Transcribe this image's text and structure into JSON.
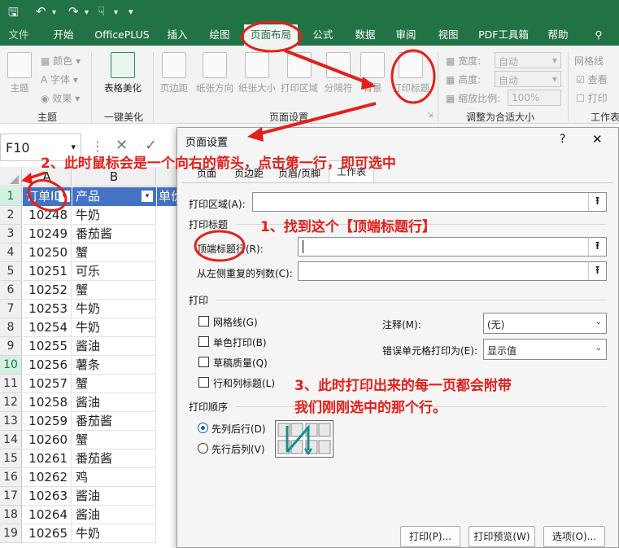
{
  "tabs": [
    "文件",
    "开始",
    "OfficePLUS",
    "插入",
    "绘图",
    "页面布局",
    "公式",
    "数据",
    "审阅",
    "视图",
    "PDF工具箱",
    "帮助"
  ],
  "ribbon": {
    "theme": {
      "btn": "主题",
      "colors": "颜色",
      "fonts": "字体",
      "effects": "效果",
      "group": "主题"
    },
    "beautify": {
      "btn": "表格美化",
      "group": "一键美化"
    },
    "page_setup": {
      "margins": "页边距",
      "orientation": "纸张方向",
      "size": "纸张大小",
      "print_area": "打印区域",
      "breaks": "分隔符",
      "background": "背景",
      "print_titles": "打印标题",
      "group": "页面设置"
    },
    "scale": {
      "width_label": "宽度:",
      "width_val": "自动",
      "height_label": "高度:",
      "height_val": "自动",
      "scale_label": "缩放比例:",
      "scale_val": "100%",
      "group": "调整为合适大小"
    },
    "sheet_opts": {
      "gridlines": "网格线",
      "view": "查看",
      "print": "打印",
      "group": "工作表"
    }
  },
  "namebox": "F10",
  "sheet": {
    "col_a": "A",
    "col_b": "B",
    "header": {
      "a": "订单ID",
      "b": "产品",
      "c": "单价"
    },
    "rows": [
      {
        "n": "2",
        "id": "10248",
        "p": "牛奶"
      },
      {
        "n": "3",
        "id": "10249",
        "p": "番茄酱"
      },
      {
        "n": "4",
        "id": "10250",
        "p": "蟹"
      },
      {
        "n": "5",
        "id": "10251",
        "p": "可乐"
      },
      {
        "n": "6",
        "id": "10252",
        "p": "蟹"
      },
      {
        "n": "7",
        "id": "10253",
        "p": "牛奶"
      },
      {
        "n": "8",
        "id": "10254",
        "p": "牛奶"
      },
      {
        "n": "9",
        "id": "10255",
        "p": "酱油"
      },
      {
        "n": "10",
        "id": "10256",
        "p": "薯条"
      },
      {
        "n": "11",
        "id": "10257",
        "p": "蟹"
      },
      {
        "n": "12",
        "id": "10258",
        "p": "酱油"
      },
      {
        "n": "13",
        "id": "10259",
        "p": "番茄酱"
      },
      {
        "n": "14",
        "id": "10260",
        "p": "蟹"
      },
      {
        "n": "15",
        "id": "10261",
        "p": "番茄酱"
      },
      {
        "n": "16",
        "id": "10262",
        "p": "鸡"
      },
      {
        "n": "17",
        "id": "10263",
        "p": "酱油"
      },
      {
        "n": "18",
        "id": "10264",
        "p": "酱油"
      },
      {
        "n": "19",
        "id": "10265",
        "p": "牛奶"
      }
    ]
  },
  "dialog": {
    "title": "页面设置",
    "help": "?",
    "close": "✕",
    "tabs": [
      "页面",
      "页边距",
      "页眉/页脚",
      "工作表"
    ],
    "print_area": "打印区域(A):",
    "print_titles": "打印标题",
    "rows_to_repeat": "顶端标题行(R):",
    "cols_to_repeat": "从左侧重复的列数(C):",
    "print": "打印",
    "gridlines": "网格线(G)",
    "bw": "单色打印(B)",
    "draft": "草稿质量(Q)",
    "headings": "行和列标题(L)",
    "comments_label": "注释(M):",
    "comments_val": "(无)",
    "errors_label": "错误单元格打印为(E):",
    "errors_val": "显示值",
    "page_order": "打印顺序",
    "down_over": "先列后行(D)",
    "over_down": "先行后列(V)",
    "btn_print": "打印(P)...",
    "btn_preview": "打印预览(W)",
    "btn_options": "选项(O)..."
  },
  "annotations": {
    "step1": "1、找到这个【顶端标题行】",
    "step2": "2、此时鼠标会是一个向右的箭头，点击第一行，即可选中",
    "step3_l1": "3、此时打印出来的每一页都会附带",
    "step3_l2": "我们刚刚选中的那个行。"
  },
  "colors": {
    "excel_green": "#217346",
    "annotation_red": "#e3201b",
    "header_fill": "#4472c4"
  }
}
